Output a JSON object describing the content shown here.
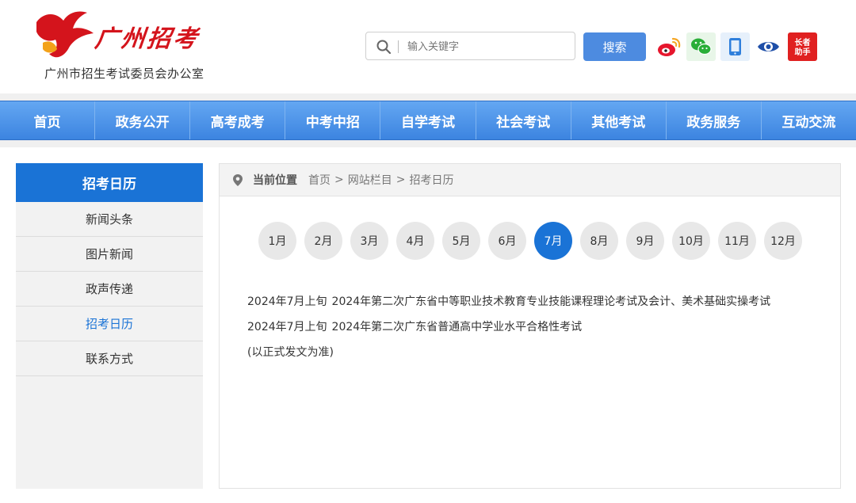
{
  "header": {
    "logo_title": "广州招考",
    "logo_subtitle": "广州市招生考试委员会办公室",
    "search_placeholder": "输入关键字",
    "search_button": "搜索",
    "social_icons": [
      "weibo-icon",
      "wechat-icon",
      "mobile-icon",
      "eye-icon",
      "elderly-assistant-icon"
    ],
    "elderly_badge": [
      "长者",
      "助手"
    ]
  },
  "nav": {
    "items": [
      "首页",
      "政务公开",
      "高考成考",
      "中考中招",
      "自学考试",
      "社会考试",
      "其他考试",
      "政务服务",
      "互动交流"
    ]
  },
  "sidebar": {
    "title": "招考日历",
    "items": [
      {
        "label": "新闻头条",
        "active": false
      },
      {
        "label": "图片新闻",
        "active": false
      },
      {
        "label": "政声传递",
        "active": false
      },
      {
        "label": "招考日历",
        "active": true
      },
      {
        "label": "联系方式",
        "active": false
      }
    ]
  },
  "breadcrumb": {
    "label": "当前位置",
    "items": [
      "首页",
      "网站栏目",
      "招考日历"
    ],
    "separator": ">"
  },
  "months": {
    "items": [
      "1月",
      "2月",
      "3月",
      "4月",
      "5月",
      "6月",
      "7月",
      "8月",
      "9月",
      "10月",
      "11月",
      "12月"
    ],
    "selected": "7月"
  },
  "events": [
    {
      "date": "2024年7月上旬",
      "title": "2024年第二次广东省中等职业技术教育专业技能课程理论考试及会计、美术基础实操考试"
    },
    {
      "date": "2024年7月上旬",
      "title": "2024年第二次广东省普通高中学业水平合格性考试"
    }
  ],
  "note": "(以正式发文为准)",
  "colors": {
    "brand_red": "#d4141c",
    "nav_blue": "#3c84e0",
    "active_blue": "#1a73d6",
    "search_button": "#4d8be0"
  }
}
